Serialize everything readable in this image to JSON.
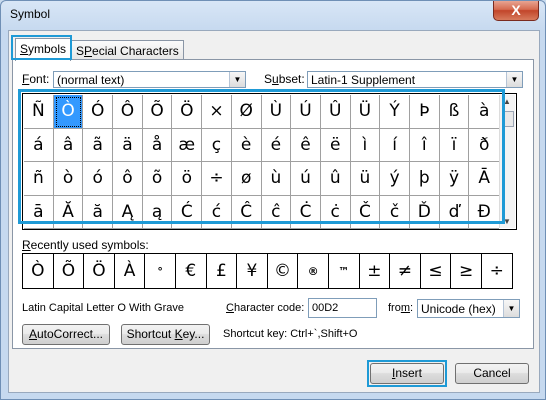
{
  "window": {
    "title": "Symbol",
    "close_label": "X"
  },
  "tabs": [
    {
      "label": "Symbols",
      "key": "S",
      "rest": "ymbols"
    },
    {
      "label": "Special Characters",
      "key": "P",
      "rest_before": "S",
      "rest_after": "ecial Characters"
    }
  ],
  "font": {
    "label_key": "F",
    "label_rest": "ont:",
    "value": "(normal text)"
  },
  "subset": {
    "label_pre": "S",
    "label_key": "u",
    "label_rest": "bset:",
    "value": "Latin-1 Supplement"
  },
  "symbols": [
    "Ñ",
    "Ò",
    "Ó",
    "Ô",
    "Õ",
    "Ö",
    "×",
    "Ø",
    "Ù",
    "Ú",
    "Û",
    "Ü",
    "Ý",
    "Þ",
    "ß",
    "à",
    "á",
    "â",
    "ã",
    "ä",
    "å",
    "æ",
    "ç",
    "è",
    "é",
    "ê",
    "ë",
    "ì",
    "í",
    "î",
    "ï",
    "ð",
    "ñ",
    "ò",
    "ó",
    "ô",
    "õ",
    "ö",
    "÷",
    "ø",
    "ù",
    "ú",
    "û",
    "ü",
    "ý",
    "þ",
    "ÿ",
    "Ā",
    "ā",
    "Ă",
    "ă",
    "Ą",
    "ą",
    "Ć",
    "ć",
    "Ĉ",
    "ĉ",
    "Ċ",
    "ċ",
    "Č",
    "č",
    "Ď",
    "ď",
    "Đ"
  ],
  "selected_symbol": "Ò",
  "recent": {
    "label_key": "R",
    "label_rest": "ecently used symbols:",
    "symbols": [
      "Ò",
      "Õ",
      "Ö",
      "À",
      "°",
      "€",
      "£",
      "¥",
      "©",
      "®",
      "™",
      "±",
      "≠",
      "≤",
      "≥",
      "÷"
    ]
  },
  "char_name": "Latin Capital Letter O With Grave",
  "char_code": {
    "label_key": "C",
    "label_rest": "haracter code:",
    "value": "00D2"
  },
  "from": {
    "label_pre": "fro",
    "label_key": "m",
    "label_rest": ":",
    "value": "Unicode (hex)"
  },
  "autocorrect": {
    "key": "A",
    "rest": "utoCorrect..."
  },
  "shortcut_key_btn": {
    "pre": "Shortcut ",
    "key": "K",
    "rest": "ey..."
  },
  "shortcut_info": "Shortcut key: Ctrl+`,Shift+O",
  "insert": {
    "key": "I",
    "rest": "nsert"
  },
  "cancel": "Cancel",
  "highlight_color": "#1e9ad6"
}
